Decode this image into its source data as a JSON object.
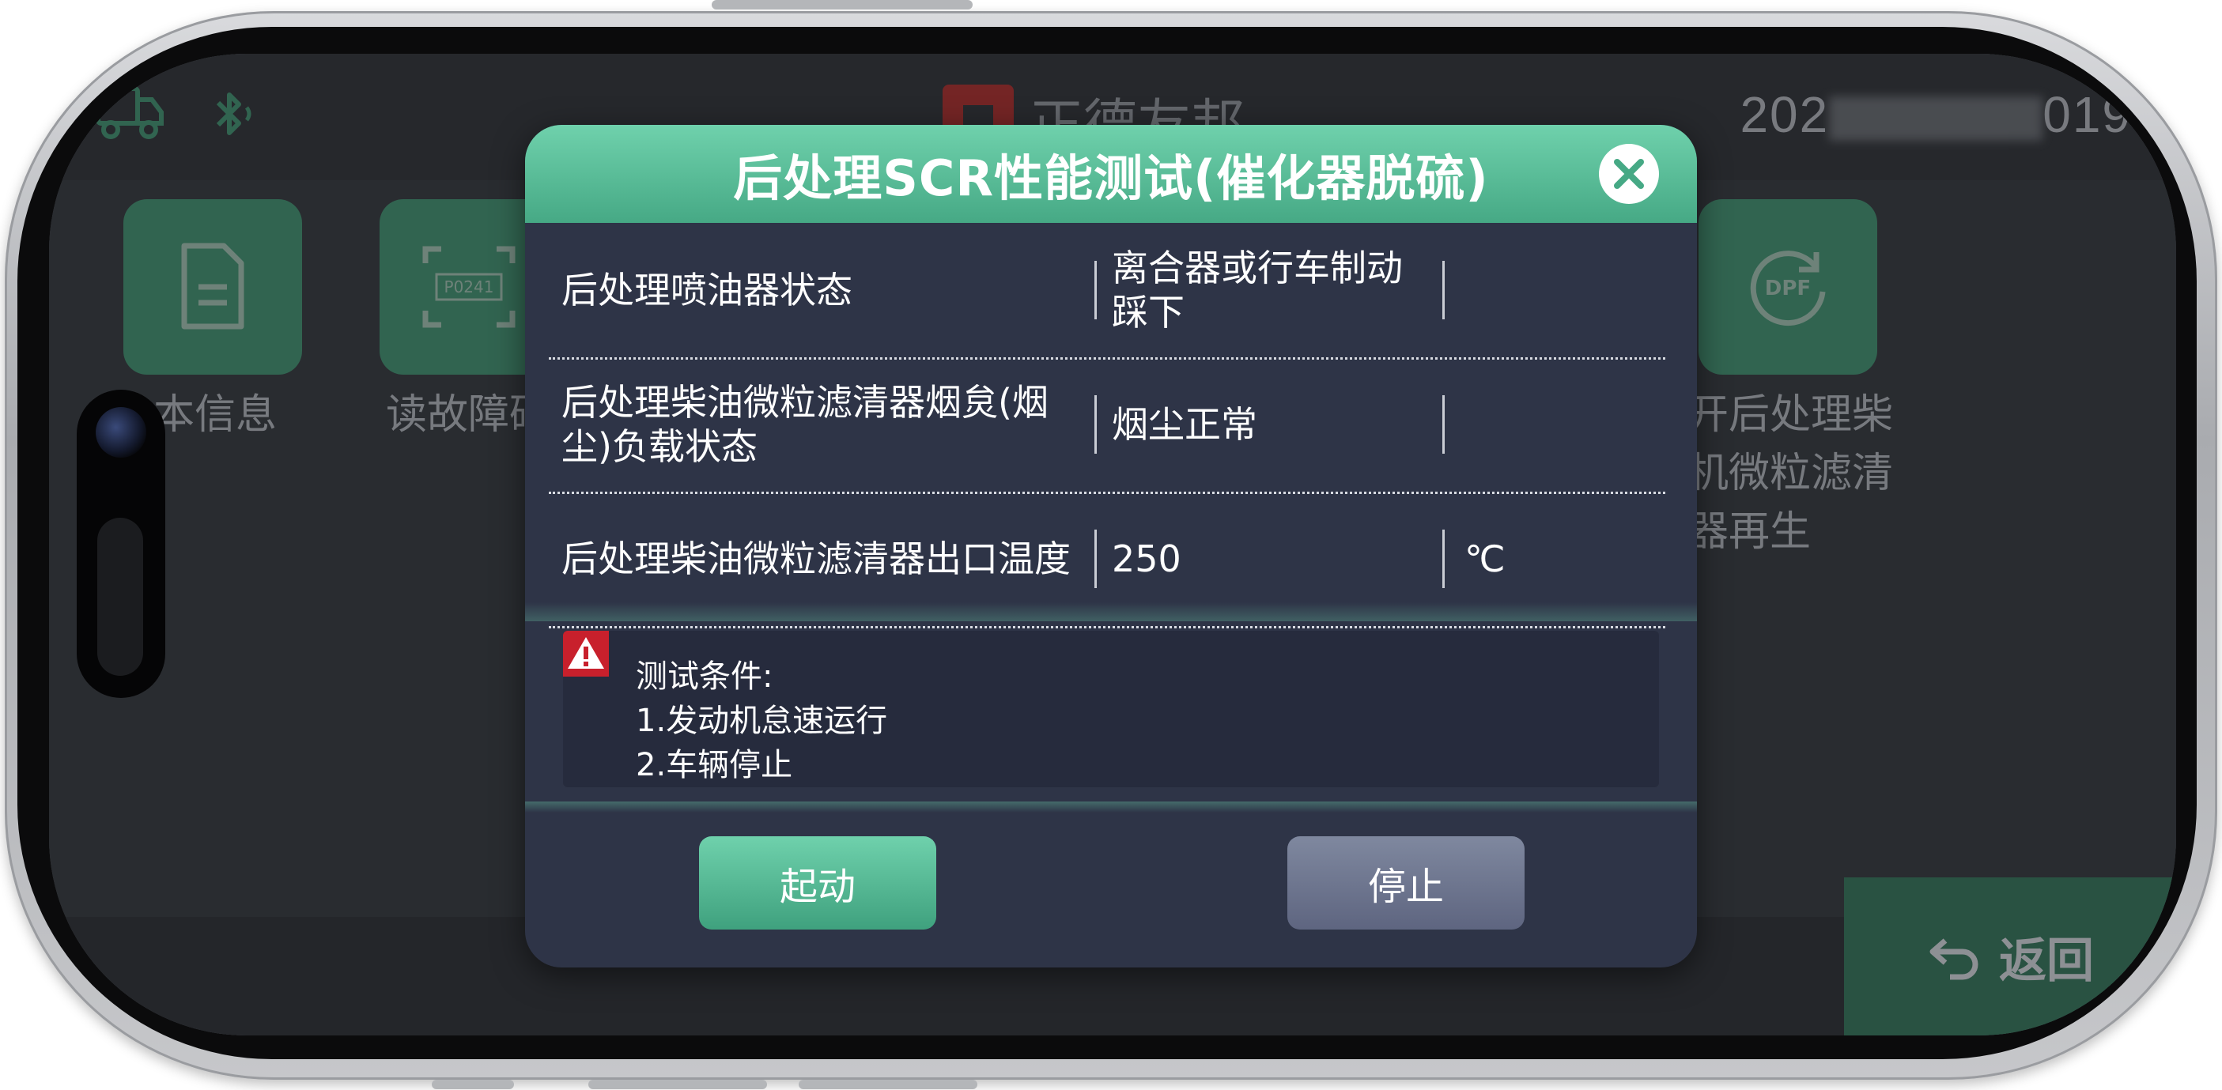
{
  "status_bar": {
    "brand_name": "正德友邦",
    "clock_prefix": "202",
    "clock_suffix": "019"
  },
  "menu_tiles": [
    {
      "label": "版本信息"
    },
    {
      "label": "读故障码"
    },
    {
      "label": "强制开启后处理柴油机微粒滤清器再生"
    }
  ],
  "menu_tiles_visible": {
    "left_label": "本信息",
    "second_label": "读故障码",
    "right_label_line1": "开后处理柴",
    "right_label_line2": "机微粒滤清",
    "right_label_line3": "器再生",
    "dpf_text": "DPF",
    "p0241_text": "P0241"
  },
  "return_button": {
    "label": "返回"
  },
  "dialog": {
    "title": "后处理SCR性能测试(催化器脱硫)",
    "rows": [
      {
        "name": "后处理喷油器状态",
        "value": "离合器或行车制动踩下",
        "unit": ""
      },
      {
        "name": "后处理柴油微粒滤清器烟炱(烟尘)负载状态",
        "value": "烟尘正常",
        "unit": ""
      },
      {
        "name": "后处理柴油微粒滤清器出口温度",
        "value": "250",
        "unit": "℃"
      }
    ],
    "notice": {
      "heading": "测试条件:",
      "line1": "1.发动机怠速运行",
      "line2": "2.车辆停止"
    },
    "start_label": "起动",
    "stop_label": "停止"
  },
  "colors": {
    "accent": "#46a985",
    "dialog_bg": "#2e3447",
    "stop_button": "#5e6580"
  }
}
